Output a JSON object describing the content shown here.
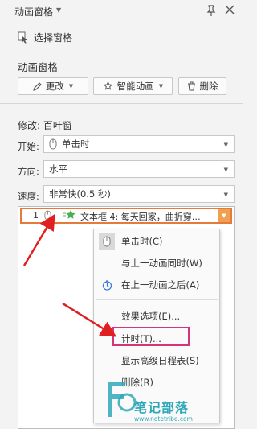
{
  "title_bar": {
    "title": "动画窗格"
  },
  "select_pane": {
    "label": "选择窗格"
  },
  "section": {
    "label": "动画窗格"
  },
  "toolbar": {
    "modify_label": "更改",
    "smart_label": "智能动画",
    "delete_label": "删除"
  },
  "effect": {
    "modify_text": "修改: 百叶窗"
  },
  "fields": {
    "start": {
      "label": "开始:",
      "value": "单击时"
    },
    "direction": {
      "label": "方向:",
      "value": "水平"
    },
    "speed": {
      "label": "速度:",
      "value": "非常快(0.5 秒)"
    }
  },
  "animation_item": {
    "number": "1",
    "text": "文本框 4: 每天回家，曲折穿…"
  },
  "context_menu": {
    "items": [
      {
        "label": "单击时(C)",
        "icon": "mouse-icon"
      },
      {
        "label": "与上一动画同时(W)",
        "icon": ""
      },
      {
        "label": "在上一动画之后(A)",
        "icon": "clock-icon"
      },
      {
        "label": "效果选项(E)...",
        "icon": ""
      },
      {
        "label": "计时(T)...",
        "icon": ""
      },
      {
        "label": "显示高级日程表(S)",
        "icon": ""
      },
      {
        "label": "删除(R)",
        "icon": ""
      }
    ]
  },
  "watermark": {
    "text": "笔记部落",
    "sub": "www.notetribe.com"
  },
  "colors": {
    "arrow": "#e02020",
    "highlight": "#d6347a",
    "item_border": "#e47b3c",
    "watermark": "#2ea8b8"
  }
}
